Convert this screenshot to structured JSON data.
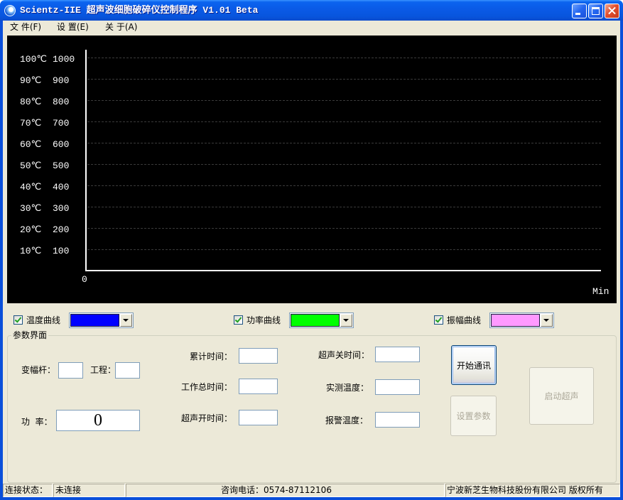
{
  "window": {
    "title": "Scientz-IIE 超声波细胞破碎仪控制程序 V1.01 Beta",
    "icons": {
      "app": "app-logo-icon",
      "minimize": "minimize-icon",
      "maximize": "maximize-icon",
      "close": "close-icon"
    }
  },
  "menu": {
    "items": [
      {
        "label": "文 件(F)"
      },
      {
        "label": "设 置(E)"
      },
      {
        "label": "关 于(A)"
      }
    ]
  },
  "chart": {
    "background": "#000000",
    "axis_color": "#FFFFFF",
    "grid": true,
    "y_ticks": [
      {
        "temp": "100℃",
        "power": 1000
      },
      {
        "temp": "90℃",
        "power": 900
      },
      {
        "temp": "80℃",
        "power": 800
      },
      {
        "temp": "70℃",
        "power": 700
      },
      {
        "temp": "60℃",
        "power": 600
      },
      {
        "temp": "50℃",
        "power": 500
      },
      {
        "temp": "40℃",
        "power": 400
      },
      {
        "temp": "30℃",
        "power": 300
      },
      {
        "temp": "20℃",
        "power": 200
      },
      {
        "temp": "10℃",
        "power": 100
      }
    ],
    "x_origin_label": "0",
    "x_unit_label": "Min"
  },
  "curves": [
    {
      "label": "温度曲线",
      "checked": true,
      "color": "#0000FF"
    },
    {
      "label": "功率曲线",
      "checked": true,
      "color": "#00FF00"
    },
    {
      "label": "振幅曲线",
      "checked": true,
      "color": "#FF99FF"
    }
  ],
  "params": {
    "group_title": "参数界面",
    "horn": {
      "label": "变幅杆：",
      "value": ""
    },
    "project": {
      "label": "工程：",
      "value": ""
    },
    "power": {
      "label": "功  率：",
      "value": "0"
    },
    "accumulated_time": {
      "label": "累计时间：",
      "value": ""
    },
    "total_work_time": {
      "label": "工作总时间：",
      "value": ""
    },
    "ultrasound_on_time": {
      "label": "超声开时间：",
      "value": ""
    },
    "ultrasound_off_time": {
      "label": "超声关时间：",
      "value": ""
    },
    "measured_temperature": {
      "label": "实测温度：",
      "value": ""
    },
    "alarm_temperature": {
      "label": "报警温度：",
      "value": ""
    }
  },
  "buttons": {
    "start_comm": {
      "label": "开始通讯",
      "enabled": true
    },
    "set_params": {
      "label": "设置参数",
      "enabled": false
    },
    "start_ultrasound": {
      "label": "启动超声",
      "enabled": false
    }
  },
  "status_bar": {
    "connection_label": "连接状态：",
    "connection_value": "未连接",
    "phone": "咨询电话：0574-87112106",
    "copyright": "宁波新芝生物科技股份有限公司 版权所有"
  }
}
